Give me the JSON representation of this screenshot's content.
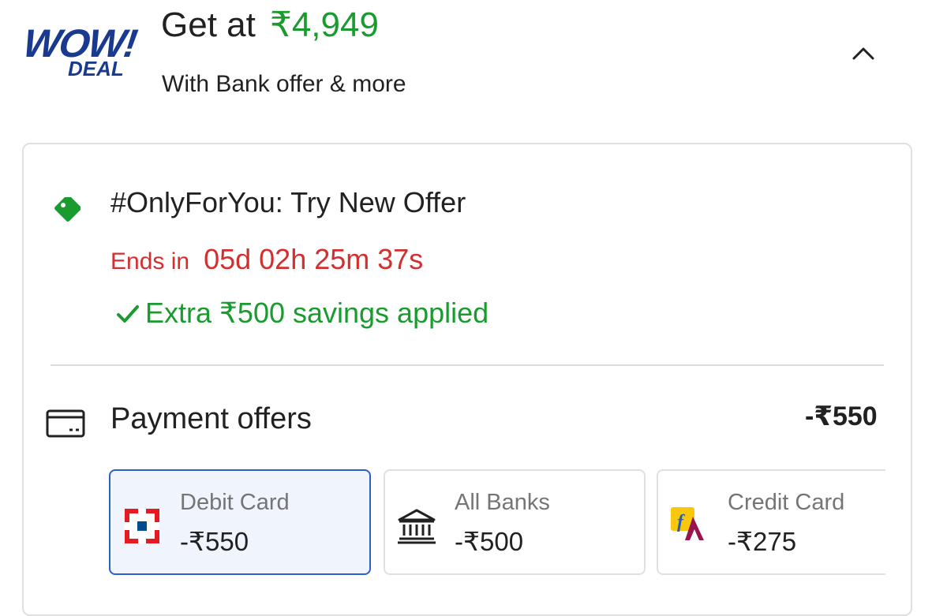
{
  "header": {
    "logo_top": "WOW!",
    "logo_bottom": "DEAL",
    "get_at_label": "Get at",
    "price": "₹4,949",
    "subtitle": "With Bank offer & more"
  },
  "offer": {
    "title": "#OnlyForYou: Try New Offer",
    "ends_label": "Ends in",
    "countdown": "05d 02h 25m 37s",
    "savings_text": "Extra ₹500 savings applied"
  },
  "payment": {
    "title": "Payment offers",
    "total": "-₹550",
    "tiles": [
      {
        "name": "Debit Card",
        "amount": "-₹550",
        "icon": "hdfc-bank-icon",
        "selected": true
      },
      {
        "name": "All Banks",
        "amount": "-₹500",
        "icon": "bank-building-icon",
        "selected": false
      },
      {
        "name": "Credit Card",
        "amount": "-₹275",
        "icon": "flipkart-axis-card-icon",
        "selected": false
      }
    ]
  },
  "colors": {
    "green": "#1a9b2f",
    "red": "#d32f2f",
    "brand_blue": "#1a3a8f",
    "selected_border": "#2f5fc6"
  }
}
